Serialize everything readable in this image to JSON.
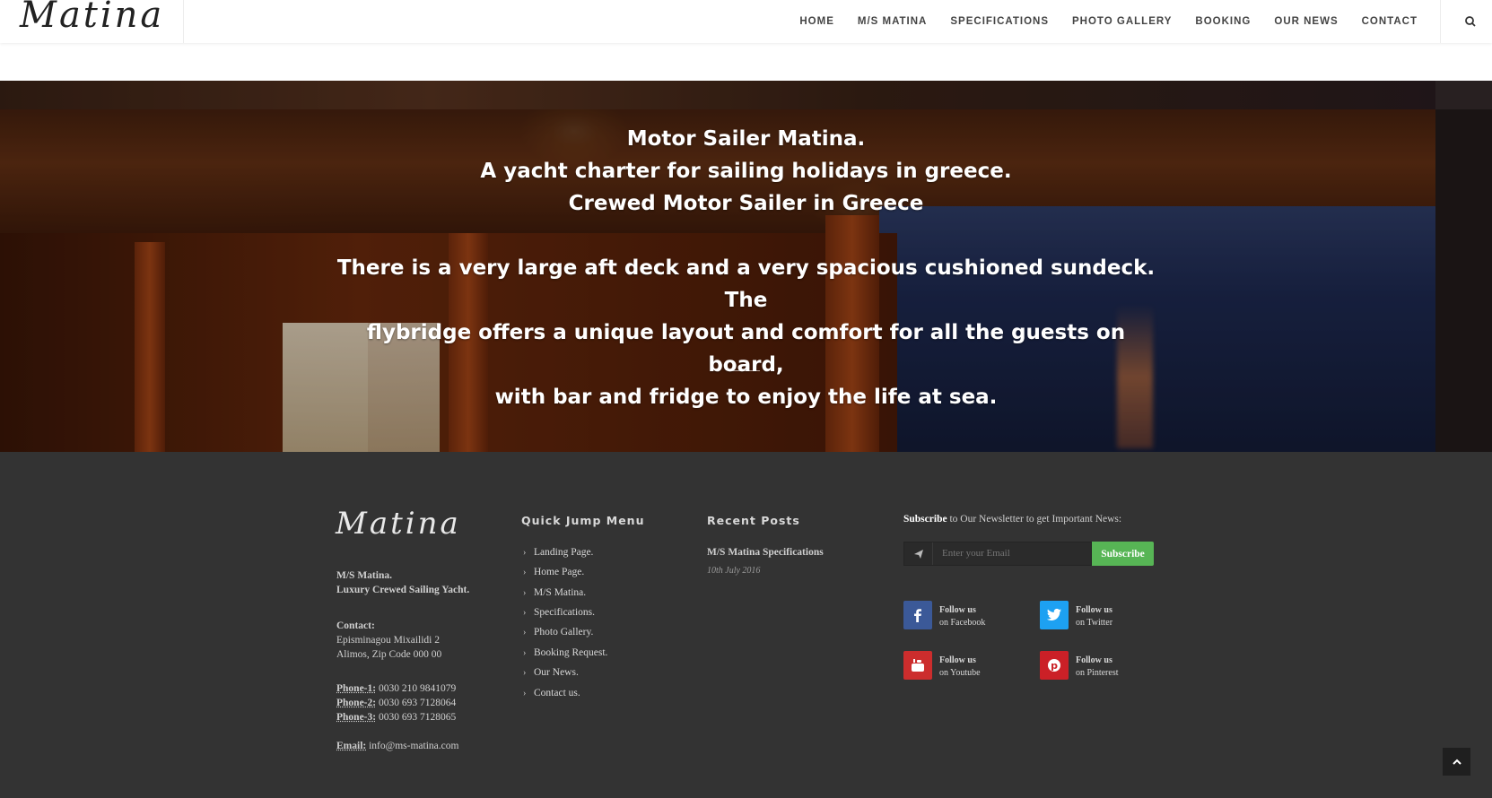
{
  "header": {
    "logo_text": "Matina",
    "nav": [
      "HOME",
      "M/S MATINA",
      "SPECIFICATIONS",
      "PHOTO GALLERY",
      "BOOKING",
      "OUR NEWS",
      "CONTACT"
    ]
  },
  "hero": {
    "title_lines": [
      "Motor Sailer Matina.",
      "A yacht charter for sailing holidays in greece.",
      "Crewed Motor Sailer in Greece"
    ],
    "description_lines": [
      "There is a very large aft deck and a very spacious cushioned sundeck. The",
      "flybridge offers a unique layout and comfort for all the guests on board,",
      "with bar and fridge to enjoy the life at sea."
    ]
  },
  "footer": {
    "logo_text": "Matina",
    "about": {
      "name": "M/S Matina.",
      "tagline": "Luxury Crewed Sailing Yacht.",
      "contact_label": "Contact:",
      "address_1": "Episminagou Mixailidi 2",
      "address_2": "Alimos, Zip Code 000 00",
      "phones": [
        {
          "label": "Phone-1:",
          "value": "0030 210 9841079"
        },
        {
          "label": "Phone-2:",
          "value": "0030 693 7128064"
        },
        {
          "label": "Phone-3:",
          "value": "0030 693 7128065"
        }
      ],
      "email_label": "Email:",
      "email": "info@ms-matina.com"
    },
    "quick_jump": {
      "title": "Quick Jump Menu",
      "items": [
        "Landing Page.",
        "Home Page.",
        "M/S Matina.",
        "Specifications.",
        "Photo Gallery.",
        "Booking Request.",
        "Our News.",
        "Contact us."
      ]
    },
    "recent_posts": {
      "title": "Recent Posts",
      "posts": [
        {
          "title": "M/S Matina Specifications",
          "date": "10th July 2016"
        }
      ]
    },
    "newsletter": {
      "bold": "Subscribe",
      "text": " to Our Newsletter to get Important News:",
      "placeholder": "Enter your Email",
      "button": "Subscribe"
    },
    "social": [
      {
        "line1": "Follow us",
        "line2": "on Facebook",
        "icon": "facebook-icon",
        "color": "#3b5998"
      },
      {
        "line1": "Follow us",
        "line2": "on Twitter",
        "icon": "twitter-icon",
        "color": "#1da1f2"
      },
      {
        "line1": "Follow us",
        "line2": "on Youtube",
        "icon": "youtube-icon",
        "color": "#cc2d2d"
      },
      {
        "line1": "Follow us",
        "line2": "on Pinterest",
        "icon": "pinterest-icon",
        "color": "#cb2027"
      }
    ]
  }
}
